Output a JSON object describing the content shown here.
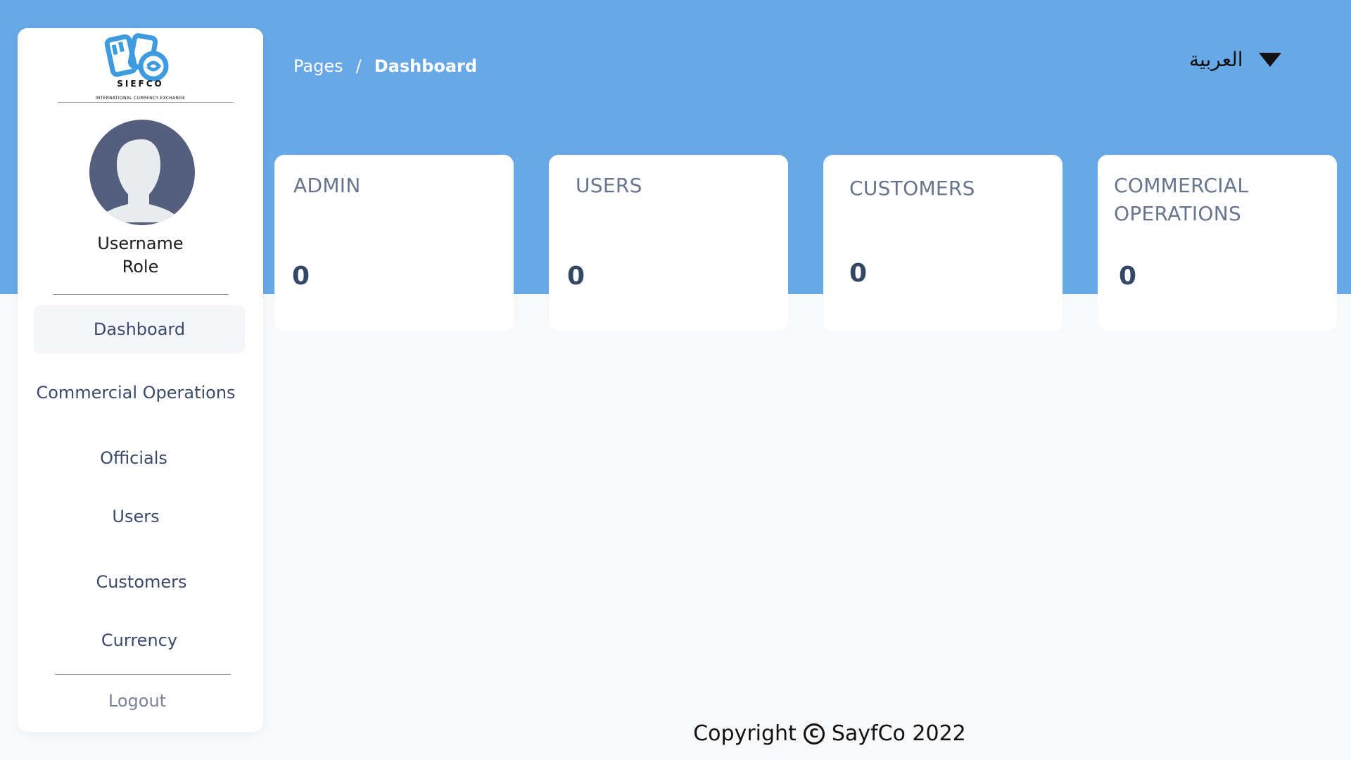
{
  "brand": {
    "name": "SIEFCO",
    "tagline": "INTERNATIONAL CURRENCY EXCHANGE",
    "accent": "#68a8e6",
    "logo_blue": "#3e9be0"
  },
  "profile": {
    "username": "Username",
    "role": "Role"
  },
  "sidebar": {
    "items": [
      {
        "label": "Dashboard",
        "active": true
      },
      {
        "label": "Commercial Operations"
      },
      {
        "label": "Officials"
      },
      {
        "label": "Users"
      },
      {
        "label": "Customers"
      },
      {
        "label": "Currency"
      }
    ],
    "logout_label": "Logout"
  },
  "breadcrumb": {
    "parent": "Pages",
    "separator": "/",
    "current": "Dashboard"
  },
  "language": {
    "label": "العربية",
    "icon": "caret-down-icon"
  },
  "cards": [
    {
      "title_line1": "ADMIN",
      "value": "0"
    },
    {
      "title_line1": "USERS",
      "value": "0"
    },
    {
      "title_line1": "CUSTOMERS",
      "value": "0"
    },
    {
      "title_line1": "COMMERCIAL",
      "title_line2": "OPERATIONS",
      "value": "0"
    }
  ],
  "footer": {
    "prefix": "Copyright",
    "symbol": "C",
    "text": "SayfCo 2022"
  }
}
